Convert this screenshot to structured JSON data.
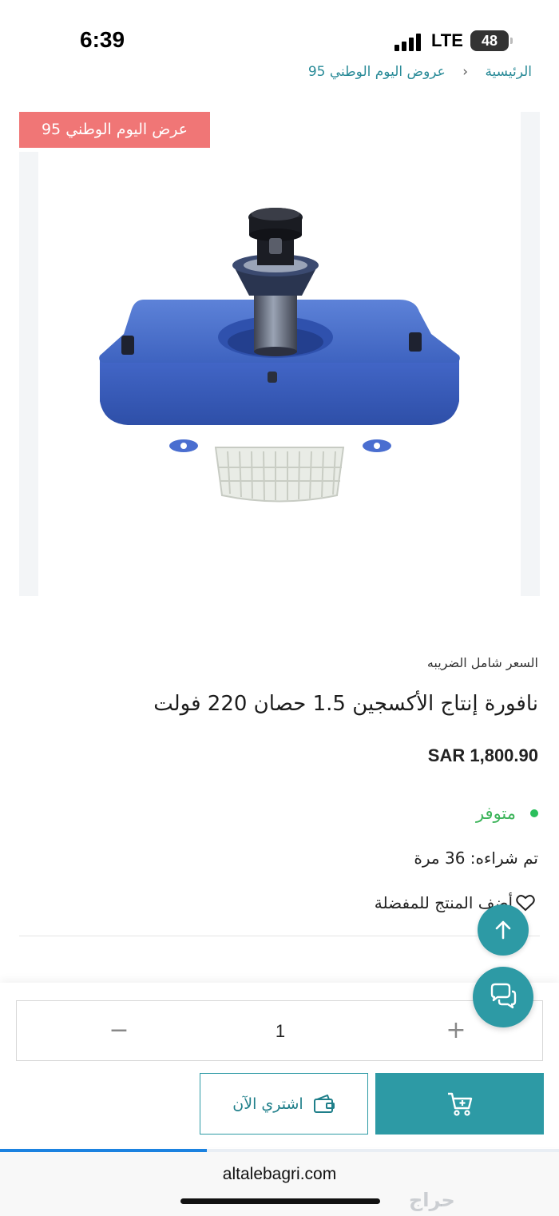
{
  "status_bar": {
    "time": "6:39",
    "network": "LTE",
    "battery": "48"
  },
  "breadcrumb": {
    "home": "الرئيسية",
    "category": "عروض اليوم الوطني 95"
  },
  "product": {
    "badge": "عرض اليوم الوطني 95",
    "tax_note": "السعر شامل الضريبه",
    "title": "نافورة إنتاج الأكسجين 1.5 حصان 220 فولت",
    "price": "SAR 1,800.90",
    "stock_status": "متوفر",
    "bought_count": "تم شراءه: 36 مرة",
    "favorite_label": "أضف المنتج للمفضلة"
  },
  "purchase": {
    "quantity": "1",
    "minus_symbol": "−",
    "plus_symbol": "+",
    "buy_now_label": "اشتري الآن"
  },
  "browser": {
    "url": "altalebagri.com",
    "load_progress_percent": 37
  },
  "watermark": "حراج",
  "colors": {
    "accent": "#2d9aa5",
    "badge": "#f07676",
    "in_stock": "#3cb45a",
    "progress": "#1b82e0"
  },
  "icons": {
    "favorite": "heart-outline-icon",
    "buy_now": "wallet-icon",
    "add_to_cart": "cart-plus-icon",
    "scroll_up": "arrow-up-icon",
    "chat": "chat-bubbles-icon"
  }
}
